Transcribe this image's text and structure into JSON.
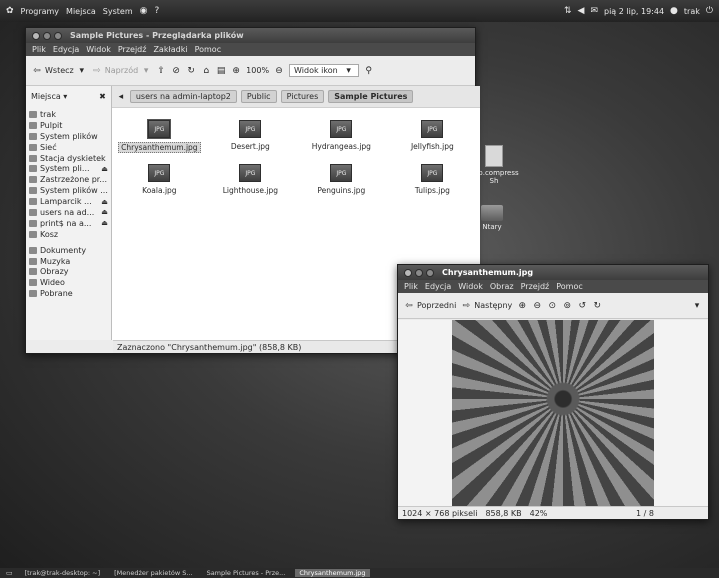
{
  "top_panel": {
    "menus": [
      "Programy",
      "Miejsca",
      "System"
    ],
    "clock": "pią 2 lip, 19:44",
    "user": "trak"
  },
  "desktop": {
    "icons": [
      {
        "label": "…ip.compress\nSh"
      },
      {
        "label": "Ntary"
      }
    ]
  },
  "file_manager": {
    "title": "Sample Pictures - Przeglądarka plików",
    "menu": [
      "Plik",
      "Edycja",
      "Widok",
      "Przejdź",
      "Zakładki",
      "Pomoc"
    ],
    "toolbar": {
      "back": "Wstecz",
      "forward": "Naprzód",
      "zoom": "100%",
      "view_mode": "Widok ikon"
    },
    "sidebar": {
      "header": "Miejsca",
      "items": [
        {
          "label": "trak",
          "eject": false
        },
        {
          "label": "Pulpit",
          "eject": false
        },
        {
          "label": "System plików",
          "eject": false
        },
        {
          "label": "Sieć",
          "eject": false
        },
        {
          "label": "Stacja dyskietek",
          "eject": false
        },
        {
          "label": "System pli...",
          "eject": true
        },
        {
          "label": "Zastrzeżone pr...",
          "eject": false
        },
        {
          "label": "System plików ...",
          "eject": false
        },
        {
          "label": "Lamparcik ...",
          "eject": true
        },
        {
          "label": "users na ad...",
          "eject": true
        },
        {
          "label": "print$ na a...",
          "eject": true
        },
        {
          "label": "Kosz",
          "eject": false
        }
      ],
      "bookmarks": [
        "Dokumenty",
        "Muzyka",
        "Obrazy",
        "Wideo",
        "Pobrane"
      ]
    },
    "path": [
      "users na admin-laptop2",
      "Public",
      "Pictures",
      "Sample Pictures"
    ],
    "files": [
      {
        "name": "Chrysanthemum.jpg",
        "selected": true
      },
      {
        "name": "Desert.jpg",
        "selected": false
      },
      {
        "name": "Hydrangeas.jpg",
        "selected": false
      },
      {
        "name": "Jellyfish.jpg",
        "selected": false
      },
      {
        "name": "Koala.jpg",
        "selected": false
      },
      {
        "name": "Lighthouse.jpg",
        "selected": false
      },
      {
        "name": "Penguins.jpg",
        "selected": false
      },
      {
        "name": "Tulips.jpg",
        "selected": false
      }
    ],
    "thumb_label": "JPG",
    "status": "Zaznaczono \"Chrysanthemum.jpg\" (858,8 KB)"
  },
  "image_viewer": {
    "title": "Chrysanthemum.jpg",
    "menu": [
      "Plik",
      "Edycja",
      "Widok",
      "Obraz",
      "Przejdź",
      "Pomoc"
    ],
    "toolbar": {
      "prev": "Poprzedni",
      "next": "Następny"
    },
    "status": {
      "dimensions": "1024 × 768 pikseli",
      "size": "858,8 KB",
      "zoom": "42%",
      "position": "1 / 8"
    }
  },
  "taskbar": {
    "tasks": [
      {
        "label": "[trak@trak-desktop: ~]",
        "active": false
      },
      {
        "label": "[Menedżer pakietów S...",
        "active": false
      },
      {
        "label": "Sample Pictures - Prze...",
        "active": false
      },
      {
        "label": "Chrysanthemum.jpg",
        "active": true
      }
    ]
  }
}
